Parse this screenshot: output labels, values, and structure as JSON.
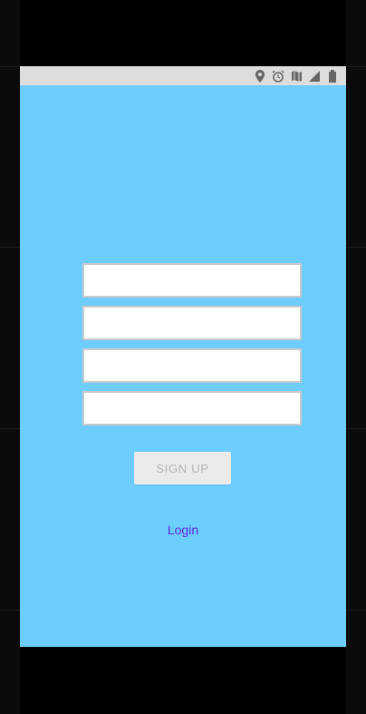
{
  "status_bar": {
    "icons": [
      "location-pin-icon",
      "alarm-icon",
      "map-icon",
      "signal-icon",
      "battery-icon"
    ]
  },
  "form": {
    "fields": [
      {
        "value": "",
        "placeholder": ""
      },
      {
        "value": "",
        "placeholder": ""
      },
      {
        "value": "",
        "placeholder": ""
      },
      {
        "value": "",
        "placeholder": ""
      }
    ],
    "signup_label": "SIGN UP",
    "login_label": "Login"
  },
  "colors": {
    "screen_background": "#6dcdfd",
    "status_bar_background": "#dddddd",
    "button_background": "#ebebeb",
    "button_text": "#b6b6b6",
    "login_link": "#5a2be0"
  }
}
